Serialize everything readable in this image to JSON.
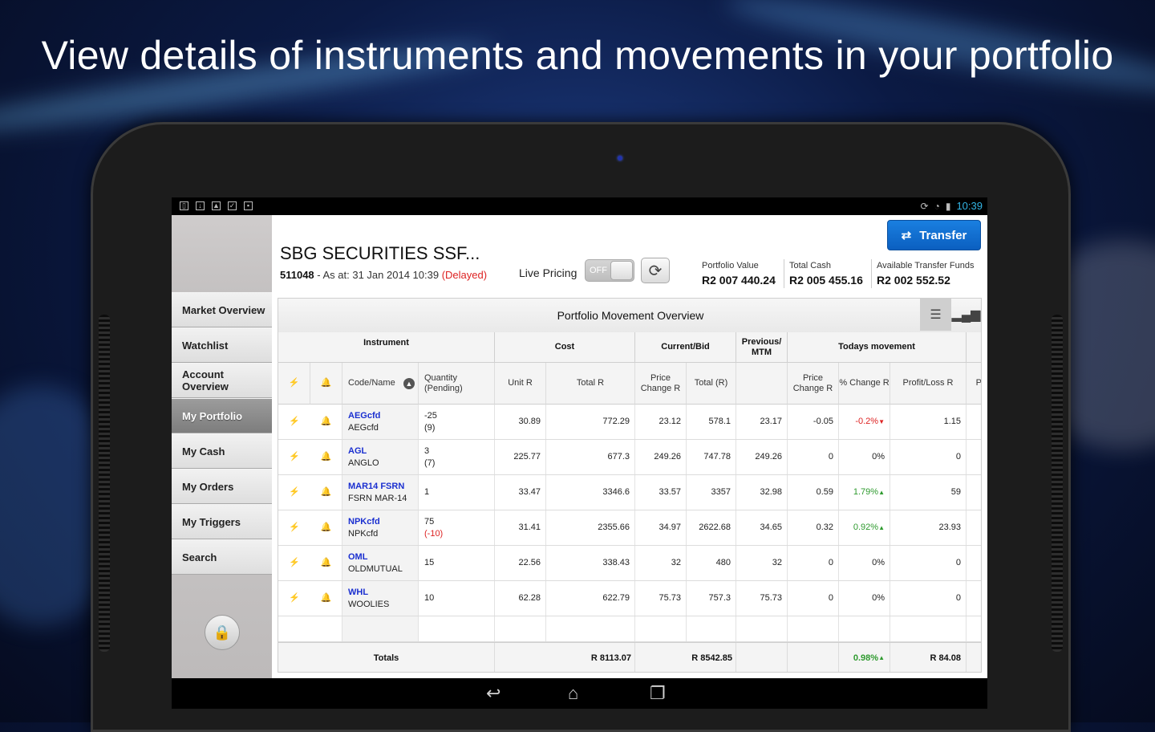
{
  "headline": "View details of instruments and movements in your portfolio",
  "status_bar": {
    "time": "10:39"
  },
  "sidebar": {
    "items": [
      {
        "label": "Market Overview"
      },
      {
        "label": "Watchlist"
      },
      {
        "label": "Account Overview"
      },
      {
        "label": "My Portfolio",
        "active": true
      },
      {
        "label": "My Cash"
      },
      {
        "label": "My Orders"
      },
      {
        "label": "My Triggers"
      },
      {
        "label": "Search"
      }
    ]
  },
  "account": {
    "title": "SBG SECURITIES SSF...",
    "number": "511048",
    "as_at": " - As at: 31 Jan 2014 10:39 ",
    "delayed": "(Delayed)",
    "live_pricing_label": "Live Pricing",
    "toggle_state": "OFF"
  },
  "transfer_button": "Transfer",
  "stats": {
    "portfolio_value": {
      "label": "Portfolio Value",
      "value": "R2 007 440.24"
    },
    "total_cash": {
      "label": "Total Cash",
      "value": "R2 005 455.16"
    },
    "available_transfer": {
      "label": "Available Transfer Funds",
      "value": "R2 002 552.52"
    }
  },
  "table": {
    "title": "Portfolio Movement Overview",
    "group_headers": {
      "instrument": "Instrument",
      "cost": "Cost",
      "current_bid": "Current/Bid",
      "previous_mtm": "Previous/ MTM",
      "todays_movement": "Todays movement"
    },
    "columns": {
      "code_name": "Code/Name",
      "quantity": "Quantity (Pending)",
      "unit_r": "Unit R",
      "total_r": "Total R",
      "price_change_r": "Price Change R",
      "total_paren_r": "Total (R)",
      "price_change_r2": "Price Change R",
      "pct_change_r": "% Change R",
      "profit_loss_r": "Profit/Loss R",
      "truncated": "P"
    },
    "rows": [
      {
        "code": "AEGcfd",
        "name": "AEGcfd",
        "qty": "-25",
        "pending": "(9)",
        "pending_red": false,
        "unit": "30.89",
        "total": "772.29",
        "cur_price_change": "23.12",
        "cur_total": "578.1",
        "prev_mtm": "23.17",
        "today_price_change": "-0.05",
        "pct": "-0.2%",
        "pct_dir": "down",
        "pl": "1.15",
        "bell_dark": false
      },
      {
        "code": "AGL",
        "name": "ANGLO",
        "qty": "3",
        "pending": "(7)",
        "pending_red": false,
        "unit": "225.77",
        "total": "677.3",
        "cur_price_change": "249.26",
        "cur_total": "747.78",
        "prev_mtm": "249.26",
        "today_price_change": "0",
        "pct": "0%",
        "pct_dir": "none",
        "pl": "0",
        "bell_dark": true
      },
      {
        "code": "MAR14 FSRN",
        "name": "FSRN MAR-14",
        "qty": "1",
        "pending": "",
        "pending_red": false,
        "unit": "33.47",
        "total": "3346.6",
        "cur_price_change": "33.57",
        "cur_total": "3357",
        "prev_mtm": "32.98",
        "today_price_change": "0.59",
        "pct": "1.79%",
        "pct_dir": "up",
        "pl": "59",
        "bell_dark": false
      },
      {
        "code": "NPKcfd",
        "name": "NPKcfd",
        "qty": "75",
        "pending": "(-10)",
        "pending_red": true,
        "unit": "31.41",
        "total": "2355.66",
        "cur_price_change": "34.97",
        "cur_total": "2622.68",
        "prev_mtm": "34.65",
        "today_price_change": "0.32",
        "pct": "0.92%",
        "pct_dir": "up",
        "pl": "23.93",
        "bell_dark": false
      },
      {
        "code": "OML",
        "name": "OLDMUTUAL",
        "qty": "15",
        "pending": "",
        "pending_red": false,
        "unit": "22.56",
        "total": "338.43",
        "cur_price_change": "32",
        "cur_total": "480",
        "prev_mtm": "32",
        "today_price_change": "0",
        "pct": "0%",
        "pct_dir": "none",
        "pl": "0",
        "bell_dark": false
      },
      {
        "code": "WHL",
        "name": "WOOLIES",
        "qty": "10",
        "pending": "",
        "pending_red": false,
        "unit": "62.28",
        "total": "622.79",
        "cur_price_change": "75.73",
        "cur_total": "757.3",
        "prev_mtm": "75.73",
        "today_price_change": "0",
        "pct": "0%",
        "pct_dir": "none",
        "pl": "0",
        "bell_dark": false
      }
    ],
    "totals": {
      "label": "Totals",
      "cost_total": "R 8113.07",
      "current_total": "R 8542.85",
      "pct": "0.98%",
      "pl": "R 84.08"
    }
  },
  "colors": {
    "accent": "#33b5e5",
    "transfer_button": "#1a7fe0",
    "negative": "#dd2222",
    "positive": "#2e9a2e",
    "code_link": "#1a2fd0"
  },
  "icons": {
    "trigger": "lightning-icon",
    "alert": "bell-icon",
    "list_view": "list-view-icon",
    "chart_view": "bar-chart-icon",
    "refresh": "refresh-icon",
    "lock": "lock-icon"
  }
}
